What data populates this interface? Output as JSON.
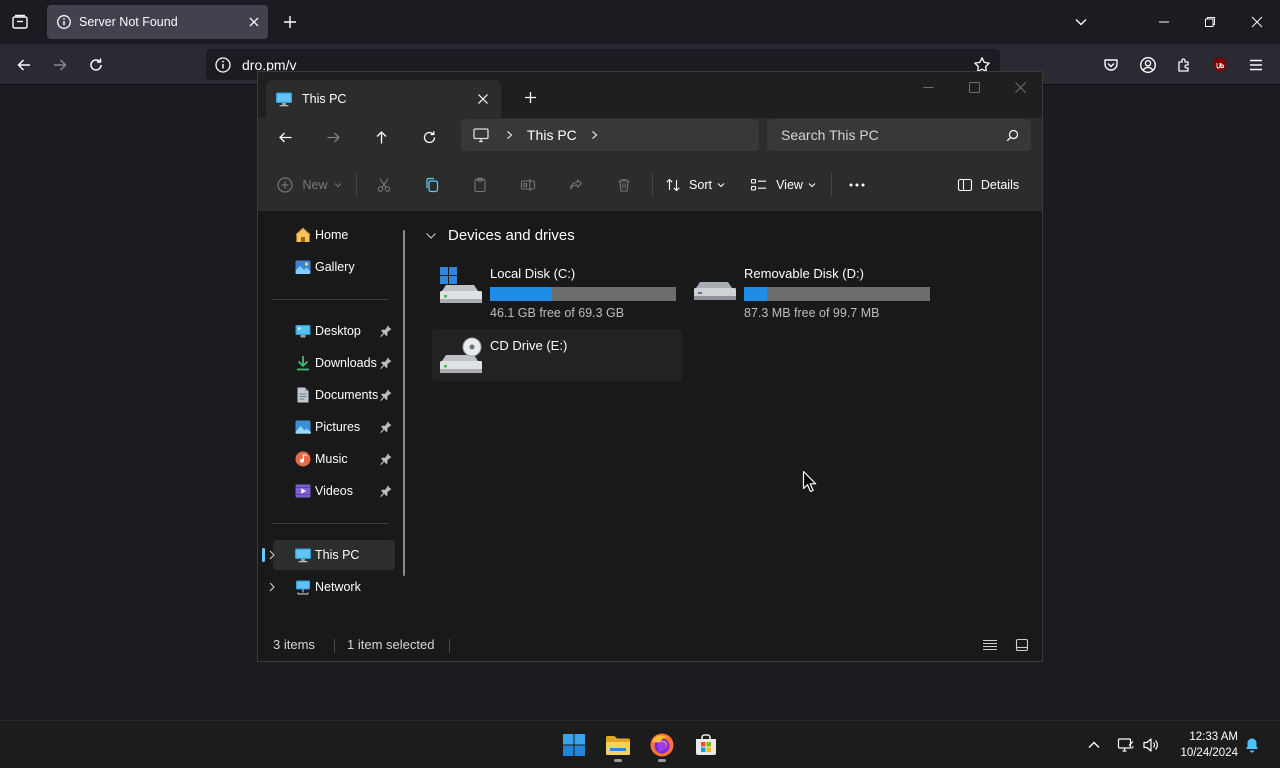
{
  "browser": {
    "tab_title": "Server Not Found",
    "url": "dro.pm/v"
  },
  "explorer": {
    "tab_title": "This PC",
    "breadcrumb": "This PC",
    "search_placeholder": "Search This PC",
    "toolbar": {
      "new_label": "New",
      "sort_label": "Sort",
      "view_label": "View",
      "details_label": "Details"
    },
    "sidebar": {
      "home": "Home",
      "gallery": "Gallery",
      "desktop": "Desktop",
      "downloads": "Downloads",
      "documents": "Documents",
      "pictures": "Pictures",
      "music": "Music",
      "videos": "Videos",
      "this_pc": "This PC",
      "network": "Network"
    },
    "section_title": "Devices and drives",
    "drives": [
      {
        "name": "Local Disk (C:)",
        "free_text": "46.1 GB free of 69.3 GB",
        "used_fraction": 0.335
      },
      {
        "name": "Removable Disk (D:)",
        "free_text": "87.3 MB free of 99.7 MB",
        "used_fraction": 0.124
      },
      {
        "name": "CD Drive (E:)"
      }
    ],
    "status": {
      "item_count": "3 items",
      "selection": "1 item selected"
    }
  },
  "taskbar": {
    "time": "12:33 AM",
    "date": "10/24/2024"
  },
  "colors": {
    "drive_bar_fill": "#1f8de6",
    "accent": "#60cdff"
  }
}
